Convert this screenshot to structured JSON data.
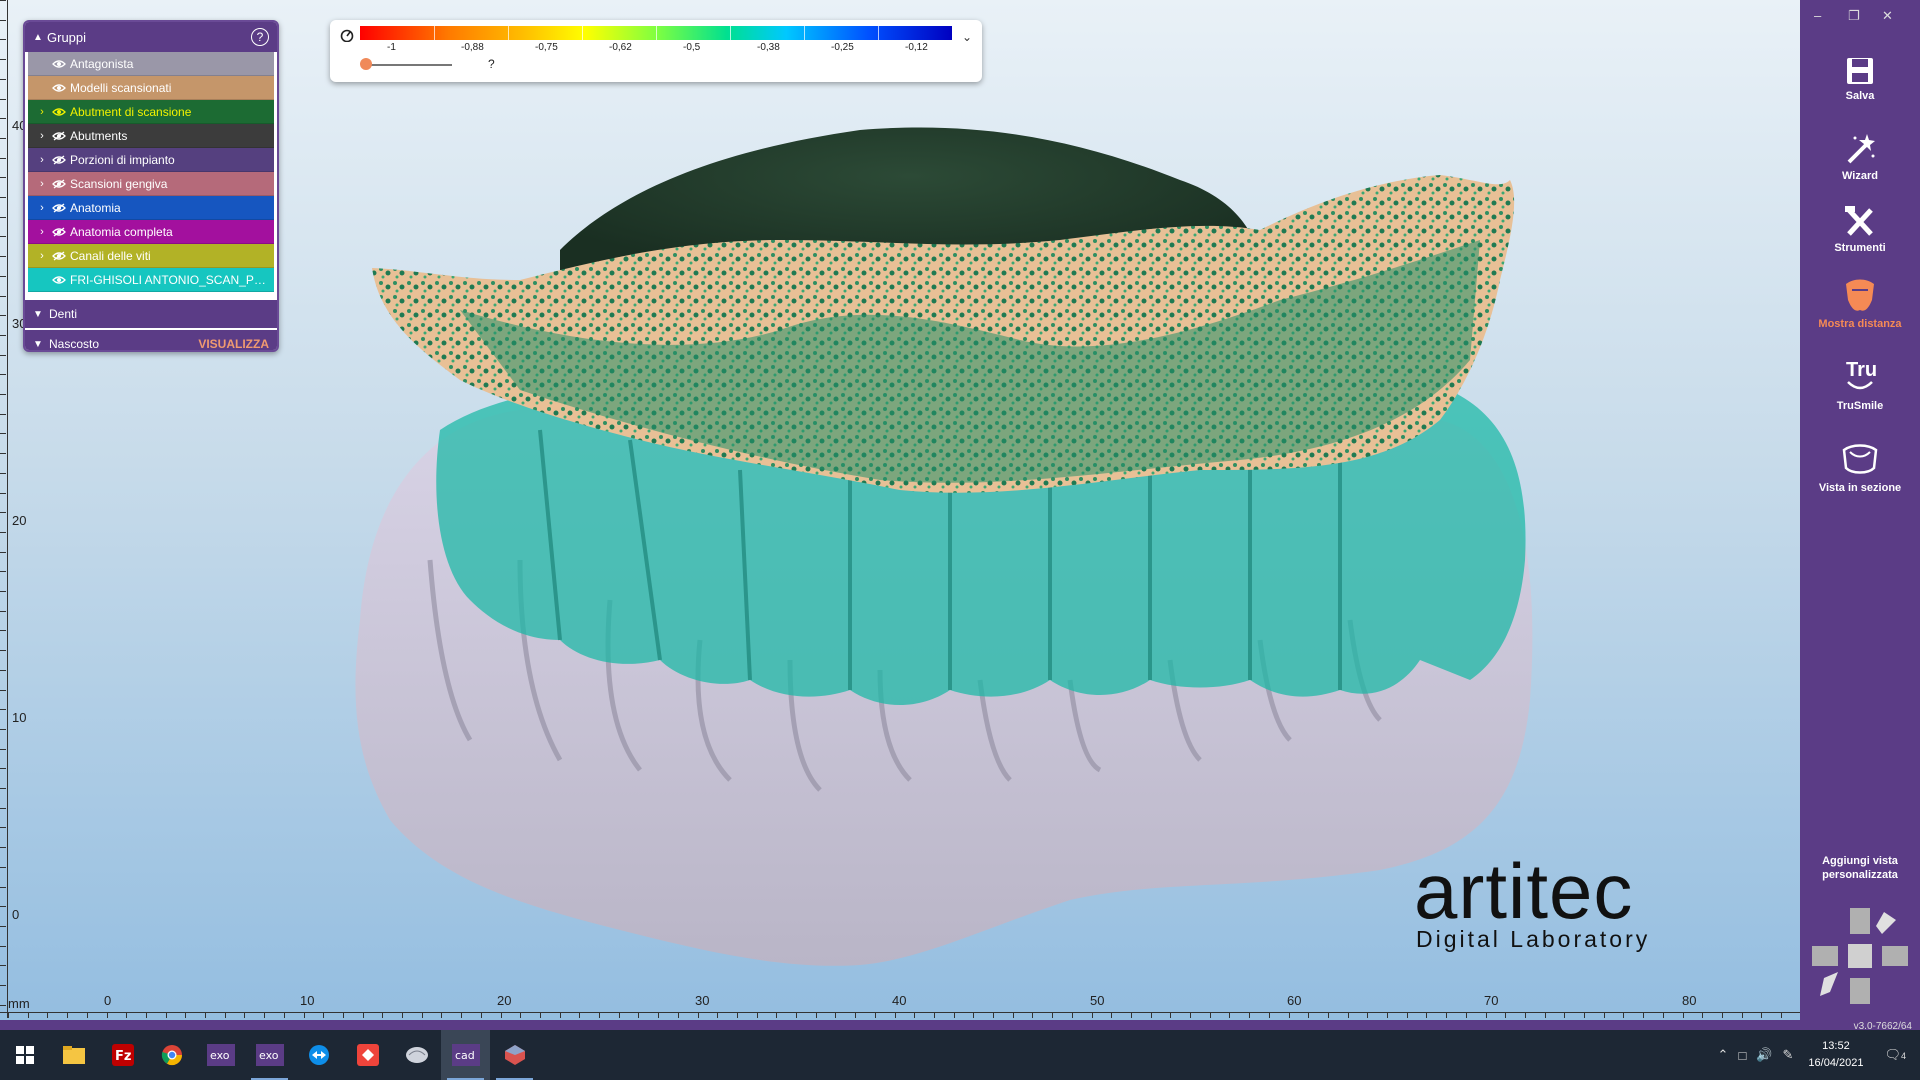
{
  "groups_panel": {
    "title": "Gruppi",
    "help": "?",
    "rows": [
      {
        "label": "Antagonista",
        "color": "#9a97a8",
        "text": "#ffffff",
        "expandable": false,
        "visible": true
      },
      {
        "label": "Modelli scansionati",
        "color": "#c5966a",
        "text": "#ffffff",
        "expandable": false,
        "visible": true
      },
      {
        "label": "Abutment di scansione",
        "color": "#1c6b33",
        "text": "#f2f200",
        "expandable": true,
        "visible": true
      },
      {
        "label": "Abutments",
        "color": "#3c3c3c",
        "text": "#ffffff",
        "expandable": true,
        "visible": false
      },
      {
        "label": "Porzioni di impianto",
        "color": "#55407f",
        "text": "#ffffff",
        "expandable": true,
        "visible": false
      },
      {
        "label": "Scansioni gengiva",
        "color": "#b56a7a",
        "text": "#ffffff",
        "expandable": true,
        "visible": false
      },
      {
        "label": "Anatomia",
        "color": "#1656c0",
        "text": "#ffffff",
        "expandable": true,
        "visible": false
      },
      {
        "label": "Anatomia completa",
        "color": "#a3109e",
        "text": "#ffffff",
        "expandable": true,
        "visible": false
      },
      {
        "label": "Canali delle viti",
        "color": "#b2b226",
        "text": "#ffffff",
        "expandable": true,
        "visible": false
      },
      {
        "label": "FRI-GHISOLI ANTONIO_SCAN_PROV...",
        "color": "#16c6c0",
        "text": "#ffffff",
        "expandable": false,
        "visible": true
      }
    ],
    "sections": [
      {
        "label": "Denti",
        "action": ""
      },
      {
        "label": "Nascosto",
        "action": "VISUALIZZA"
      }
    ]
  },
  "color_scale": {
    "labels": [
      "-1",
      "-0,88",
      "-0,75",
      "-0,62",
      "-0,5",
      "-0,38",
      "-0,25",
      "-0,12"
    ],
    "slider_value": "?",
    "slider_fraction": 0
  },
  "ruler": {
    "unit": "mm",
    "horizontal": [
      "0",
      "10",
      "20",
      "30",
      "40",
      "50",
      "60",
      "70",
      "80"
    ],
    "vertical": [
      "40",
      "30",
      "20",
      "10",
      "0"
    ]
  },
  "toolbar": {
    "window_controls": [
      "–",
      "❐",
      "✕"
    ],
    "tools": [
      {
        "label": "Salva",
        "icon": "save-icon"
      },
      {
        "label": "Wizard",
        "icon": "wizard-icon"
      },
      {
        "label": "Strumenti",
        "icon": "tools-icon"
      },
      {
        "label": "Mostra distanza",
        "icon": "distance-icon",
        "active": true
      },
      {
        "label": "TruSmile",
        "icon": "trusmile-icon"
      },
      {
        "label": "Vista in sezione",
        "icon": "section-view-icon"
      }
    ],
    "add_view": "Aggiungi vista personalizzata",
    "version": "v3.0-7662/64"
  },
  "logo": {
    "word": "artitec",
    "sub": "Digital Laboratory"
  },
  "taskbar": {
    "apps": [
      "windows-start-icon",
      "file-explorer-icon",
      "filezilla-icon",
      "chrome-icon",
      "exocad-icon",
      "exocad-icon",
      "teamviewer-icon",
      "anydesk-icon",
      "brain-app-icon",
      "dentalcad-icon",
      "meshmixer-icon"
    ],
    "exo_label": "exo",
    "cad_label": "cad",
    "fz_label": "Fz",
    "time": "13:52",
    "date": "16/04/2021",
    "notifications": "4"
  }
}
